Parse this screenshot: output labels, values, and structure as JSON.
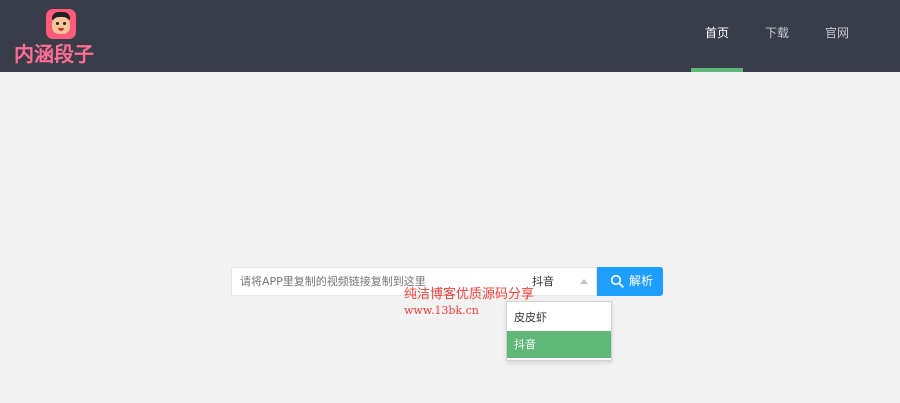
{
  "header": {
    "logo_text": "内涵段子",
    "nav": [
      {
        "label": "首页",
        "active": true
      },
      {
        "label": "下载",
        "active": false
      },
      {
        "label": "官网",
        "active": false
      }
    ]
  },
  "search": {
    "placeholder": "请将APP里复制的视频链接复制到这里",
    "value": "",
    "platform_selected": "抖音",
    "button_label": "解析",
    "button_icon": "search-icon"
  },
  "dropdown": {
    "options": [
      {
        "label": "皮皮虾",
        "selected": false
      },
      {
        "label": "抖音",
        "selected": true
      }
    ]
  },
  "watermark": {
    "line1": "纯洁博客优质源码分享",
    "line2": "www.13bk.cn"
  },
  "colors": {
    "header_bg": "#393d49",
    "accent_green": "#5fb878",
    "button_blue": "#1e9fff",
    "logo_pink": "#ff6d95",
    "watermark_red": "#ff3b3b"
  }
}
